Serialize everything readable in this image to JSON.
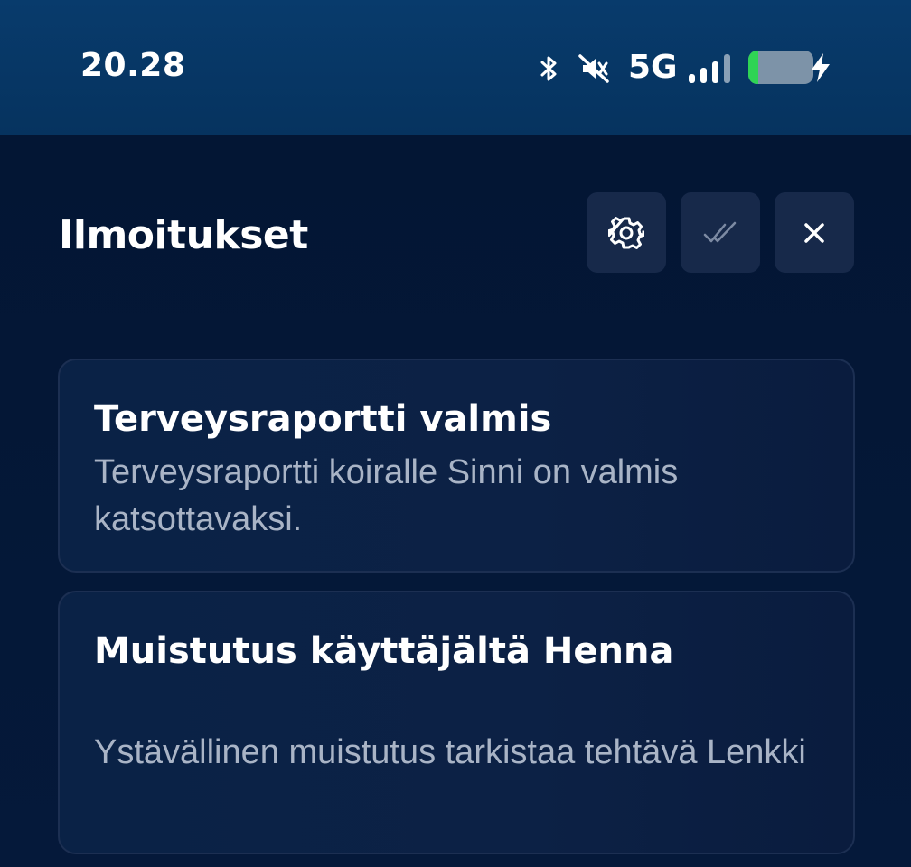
{
  "status_bar": {
    "time": "20.28",
    "network": "5G",
    "icons": [
      "bluetooth-icon",
      "muted-vibrate-icon",
      "signal-icon",
      "battery-icon",
      "charging-icon"
    ],
    "battery_level": 0.15
  },
  "header": {
    "title": "Ilmoitukset",
    "buttons": [
      "settings-icon",
      "mark-all-read-icon",
      "close-icon"
    ]
  },
  "notifications": [
    {
      "title": "Terveysraportti valmis",
      "body": "Terveysraportti koiralle Sinni on valmis katsottavaksi."
    },
    {
      "title": "Muistutus käyttäjältä Henna",
      "body": "Ystävällinen muistutus tarkistaa tehtävä Lenkki"
    }
  ],
  "colors": {
    "status_bar_bg": "#083b6c",
    "page_bg": "#041636",
    "button_bg": "#17294a",
    "card_bg": "#0b2145",
    "body_text": "#a9b4c6",
    "battery_fill": "#2fd454"
  }
}
